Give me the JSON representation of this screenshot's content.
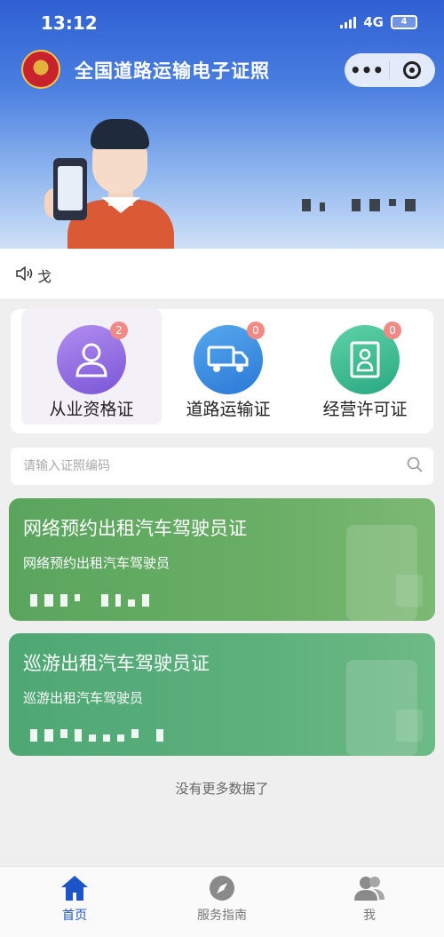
{
  "status_bar": {
    "time": "13:12",
    "network": "4G",
    "battery": "4"
  },
  "header": {
    "title": "全国道路运输电子证照",
    "more_icon": "more-dots-icon",
    "close_icon": "miniprogram-close-icon"
  },
  "notice": {
    "text": "戈"
  },
  "categories": [
    {
      "label": "从业资格证",
      "badge": "2",
      "icon": "person-icon"
    },
    {
      "label": "道路运输证",
      "badge": "0",
      "icon": "truck-icon"
    },
    {
      "label": "经营许可证",
      "badge": "0",
      "icon": "certificate-icon"
    }
  ],
  "search": {
    "placeholder": "请输入证照编码"
  },
  "licenses": [
    {
      "title": "网络预约出租汽车驾驶员证",
      "subtitle": "网络预约出租汽车驾驶员"
    },
    {
      "title": "巡游出租汽车驾驶员证",
      "subtitle": "巡游出租汽车驾驶员"
    }
  ],
  "footer_message": "没有更多数据了",
  "tabbar": [
    {
      "label": "首页",
      "icon": "home-icon",
      "active": true
    },
    {
      "label": "服务指南",
      "icon": "compass-icon",
      "active": false
    },
    {
      "label": "我",
      "icon": "user-icon",
      "active": false
    }
  ],
  "colors": {
    "primary": "#1d55c9",
    "card_green": "#5aa55e",
    "badge": "#f08a85"
  }
}
